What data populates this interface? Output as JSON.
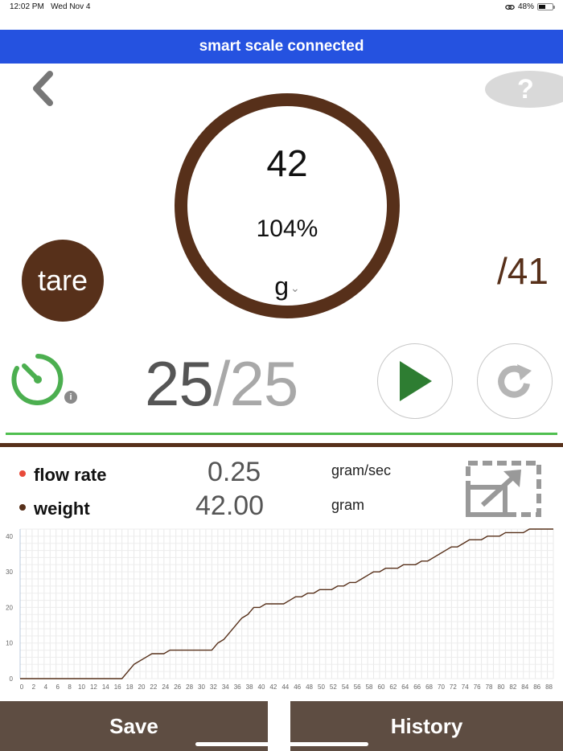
{
  "status_bar": {
    "time": "12:02 PM",
    "date": "Wed Nov 4",
    "battery": "48%",
    "battery_level": 0.48
  },
  "banner": {
    "text": "smart scale connected",
    "color": "#2552e0"
  },
  "scale": {
    "weight": "42",
    "percent": "104%",
    "unit": "g",
    "target": "/41",
    "tare_label": "tare"
  },
  "timer": {
    "current": "25",
    "separator": "/",
    "total": "25"
  },
  "legend": {
    "flow": {
      "label": "flow rate",
      "value": "0.25",
      "unit": "gram/sec",
      "color": "#e84a3a"
    },
    "weight": {
      "label": "weight",
      "value": "42.00",
      "unit": "gram",
      "color": "#57301a"
    }
  },
  "buttons": {
    "save": "Save",
    "history": "History"
  },
  "icons": {
    "back": "chevron-left-icon",
    "help": "question-icon",
    "timer": "stopwatch-icon",
    "info": "info-icon",
    "play": "play-icon",
    "reset": "refresh-icon",
    "expand": "expand-icon"
  },
  "colors": {
    "brown": "#57301a",
    "green_line": "#4fbf4f",
    "play_green": "#2e7d32",
    "bottom_bar": "#5e4d42"
  },
  "chart_data": {
    "type": "line",
    "xlim": [
      0,
      89
    ],
    "ylim": [
      0,
      42
    ],
    "x_ticks": [
      0,
      2,
      4,
      6,
      8,
      10,
      12,
      14,
      16,
      18,
      20,
      22,
      24,
      26,
      28,
      30,
      32,
      34,
      36,
      38,
      40,
      42,
      44,
      46,
      48,
      50,
      52,
      54,
      56,
      58,
      60,
      62,
      64,
      66,
      68,
      70,
      72,
      74,
      76,
      78,
      80,
      82,
      84,
      86,
      88
    ],
    "y_ticks": [
      0,
      10,
      20,
      30,
      40
    ],
    "grid": true,
    "series": [
      {
        "name": "weight",
        "color": "#57301a",
        "points": [
          [
            0,
            0
          ],
          [
            17,
            0
          ],
          [
            19,
            4
          ],
          [
            21,
            6
          ],
          [
            22,
            7
          ],
          [
            24,
            7
          ],
          [
            25,
            8
          ],
          [
            32,
            8
          ],
          [
            33,
            10
          ],
          [
            34,
            11
          ],
          [
            35,
            13
          ],
          [
            36,
            15
          ],
          [
            37,
            17
          ],
          [
            38,
            18
          ],
          [
            39,
            20
          ],
          [
            40,
            20
          ],
          [
            41,
            21
          ],
          [
            44,
            21
          ],
          [
            45,
            22
          ],
          [
            46,
            23
          ],
          [
            47,
            23
          ],
          [
            48,
            24
          ],
          [
            49,
            24
          ],
          [
            50,
            25
          ],
          [
            52,
            25
          ],
          [
            53,
            26
          ],
          [
            54,
            26
          ],
          [
            55,
            27
          ],
          [
            56,
            27
          ],
          [
            57,
            28
          ],
          [
            58,
            29
          ],
          [
            59,
            30
          ],
          [
            60,
            30
          ],
          [
            61,
            31
          ],
          [
            63,
            31
          ],
          [
            64,
            32
          ],
          [
            66,
            32
          ],
          [
            67,
            33
          ],
          [
            68,
            33
          ],
          [
            69,
            34
          ],
          [
            70,
            35
          ],
          [
            71,
            36
          ],
          [
            72,
            37
          ],
          [
            73,
            37
          ],
          [
            74,
            38
          ],
          [
            75,
            39
          ],
          [
            77,
            39
          ],
          [
            78,
            40
          ],
          [
            80,
            40
          ],
          [
            81,
            41
          ],
          [
            84,
            41
          ],
          [
            85,
            42
          ],
          [
            89,
            42
          ]
        ]
      }
    ]
  }
}
